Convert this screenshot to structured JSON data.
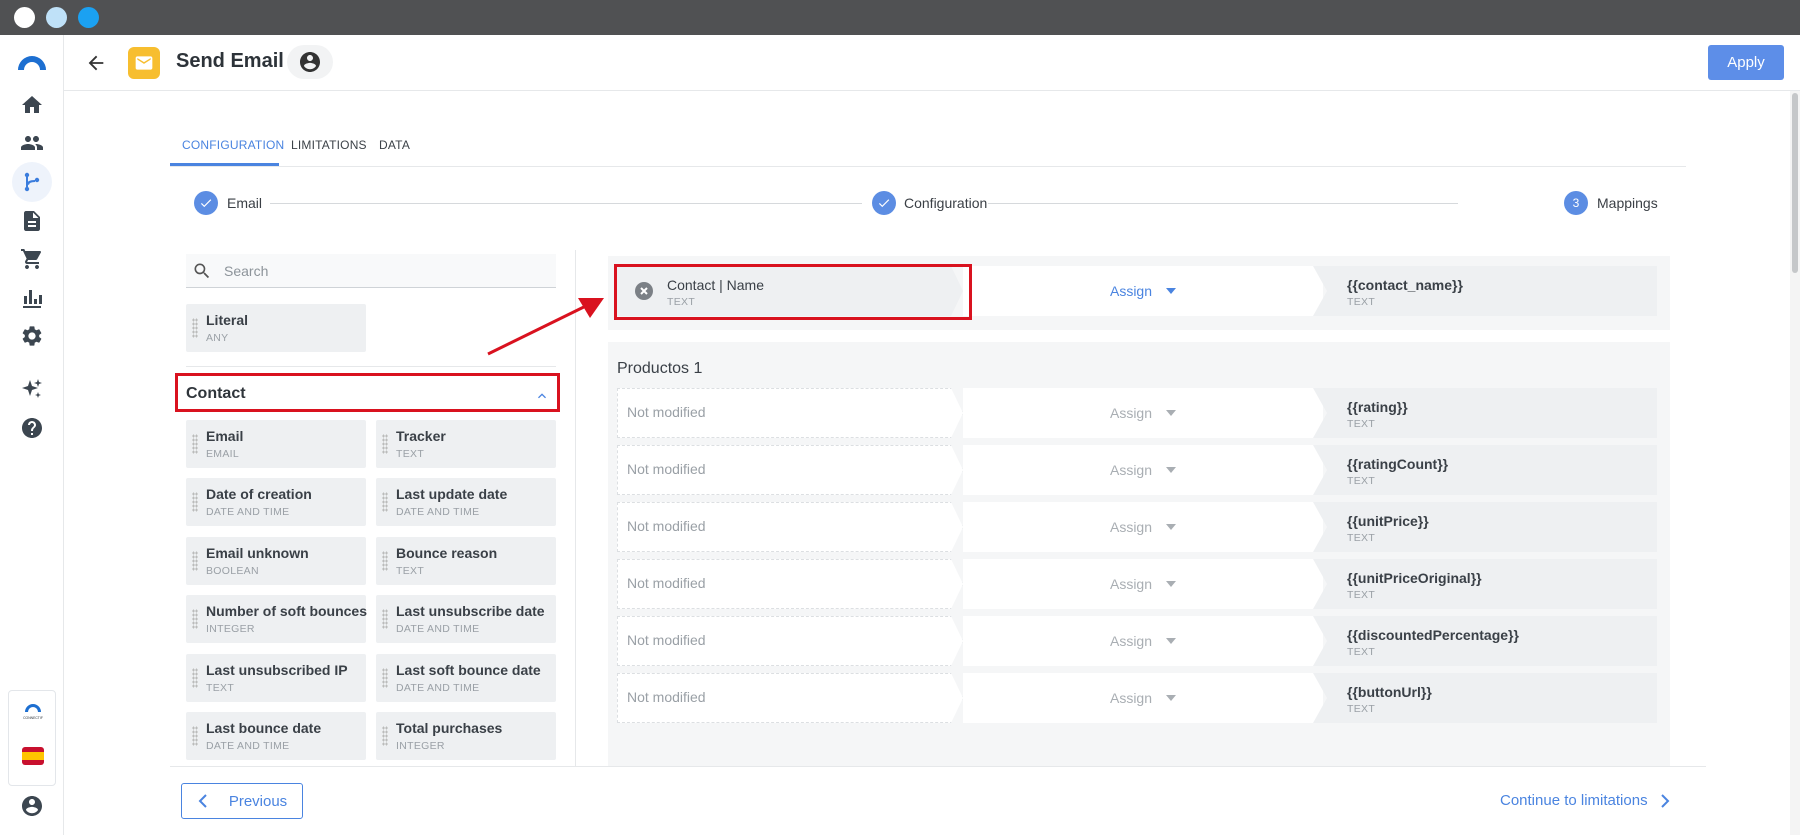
{
  "header": {
    "title": "Send Email",
    "apply_label": "Apply"
  },
  "tabs": [
    {
      "label": "CONFIGURATION",
      "active": true
    },
    {
      "label": "LIMITATIONS",
      "active": false
    },
    {
      "label": "DATA",
      "active": false
    }
  ],
  "stepper": {
    "steps": [
      {
        "label": "Email",
        "state": "done"
      },
      {
        "label": "Configuration",
        "state": "done"
      },
      {
        "label": "Mappings",
        "state": "current",
        "number": "3"
      }
    ]
  },
  "palette": {
    "search_placeholder": "Search",
    "literal": {
      "title": "Literal",
      "type": "ANY"
    },
    "contact_group": "Contact",
    "fields": [
      {
        "title": "Email",
        "type": "EMAIL"
      },
      {
        "title": "Tracker",
        "type": "TEXT"
      },
      {
        "title": "Date of creation",
        "type": "DATE AND TIME"
      },
      {
        "title": "Last update date",
        "type": "DATE AND TIME"
      },
      {
        "title": "Email unknown",
        "type": "BOOLEAN"
      },
      {
        "title": "Bounce reason",
        "type": "TEXT"
      },
      {
        "title": "Number of soft bounces",
        "type": "INTEGER"
      },
      {
        "title": "Last unsubscribe date",
        "type": "DATE AND TIME"
      },
      {
        "title": "Last unsubscribed IP",
        "type": "TEXT"
      },
      {
        "title": "Last soft bounce date",
        "type": "DATE AND TIME"
      },
      {
        "title": "Last bounce date",
        "type": "DATE AND TIME"
      },
      {
        "title": "Total purchases",
        "type": "INTEGER"
      }
    ]
  },
  "mapping": {
    "primary": {
      "source_name": "Contact | Name",
      "source_type": "TEXT",
      "action": "Assign",
      "target": "{{contact_name}}",
      "target_type": "TEXT"
    },
    "group_title": "Productos 1",
    "rows": [
      {
        "source": "Not modified",
        "action": "Assign",
        "target": "{{rating}}",
        "target_type": "TEXT"
      },
      {
        "source": "Not modified",
        "action": "Assign",
        "target": "{{ratingCount}}",
        "target_type": "TEXT"
      },
      {
        "source": "Not modified",
        "action": "Assign",
        "target": "{{unitPrice}}",
        "target_type": "TEXT"
      },
      {
        "source": "Not modified",
        "action": "Assign",
        "target": "{{unitPriceOriginal}}",
        "target_type": "TEXT"
      },
      {
        "source": "Not modified",
        "action": "Assign",
        "target": "{{discountedPercentage}}",
        "target_type": "TEXT"
      },
      {
        "source": "Not modified",
        "action": "Assign",
        "target": "{{buttonUrl}}",
        "target_type": "TEXT"
      }
    ]
  },
  "footer": {
    "previous_label": "Previous",
    "next_label": "Continue to limitations"
  },
  "sidebar": {
    "brand_mini_label": "CONNECTIF",
    "items": [
      "home-icon",
      "contacts-icon",
      "workflows-icon",
      "documents-icon",
      "cart-icon",
      "analytics-icon",
      "settings-icon",
      "sparkle-icon",
      "help-icon",
      "user-icon"
    ]
  },
  "colors": {
    "accent": "#4a84e0",
    "apply_bg": "#5d8ee8",
    "mail_badge": "#f7be2f",
    "annotation": "#d9121f",
    "titlebar": "#505153"
  }
}
